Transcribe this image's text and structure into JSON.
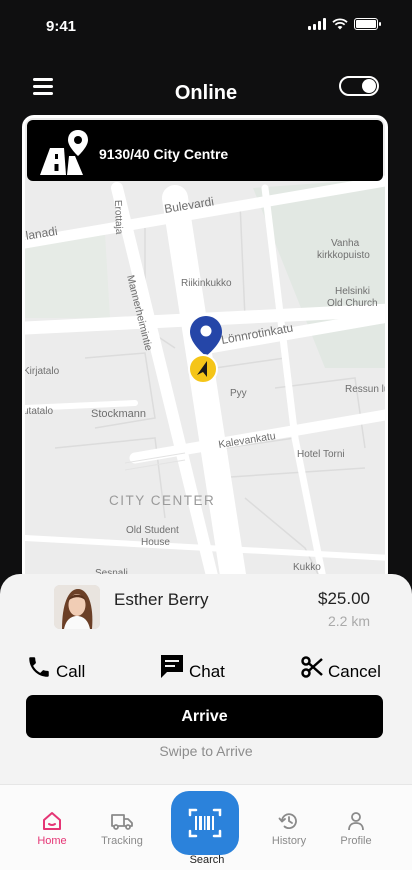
{
  "status_bar": {
    "time": "9:41"
  },
  "header": {
    "title": "Online"
  },
  "route": {
    "location": "9130/40 City Centre"
  },
  "map": {
    "street_labels": [
      "Bulevardi",
      "Ilanadi",
      "Erottaja",
      "Mannerheimintie",
      "Lönnrotinkatu",
      "Kalevankatu",
      "Kirjatalo",
      "utatalo",
      "Stockmann",
      "Riikinkukko",
      "Pyy",
      "Ressun lu",
      "Hotel Torni",
      "Vanha kirkkopuisto",
      "Helsinki Old Church",
      "Old Student House",
      "Kukko",
      "Sesnali"
    ],
    "district_label": "CITY CENTER"
  },
  "rider": {
    "name": "Esther Berry",
    "fare": "$25.00",
    "distance": "2.2 km"
  },
  "actions": {
    "call": "Call",
    "chat": "Chat",
    "cancel": "Cancel",
    "arrive": "Arrive",
    "swipe_hint": "Swipe to Arrive"
  },
  "tabs": {
    "home": "Home",
    "tracking": "Tracking",
    "search": "Search",
    "history": "History",
    "profile": "Profile"
  },
  "colors": {
    "accent_active": "#e53575",
    "scan_button": "#2b82db",
    "pin": "#2546a8",
    "location_marker": "#f5c518"
  }
}
